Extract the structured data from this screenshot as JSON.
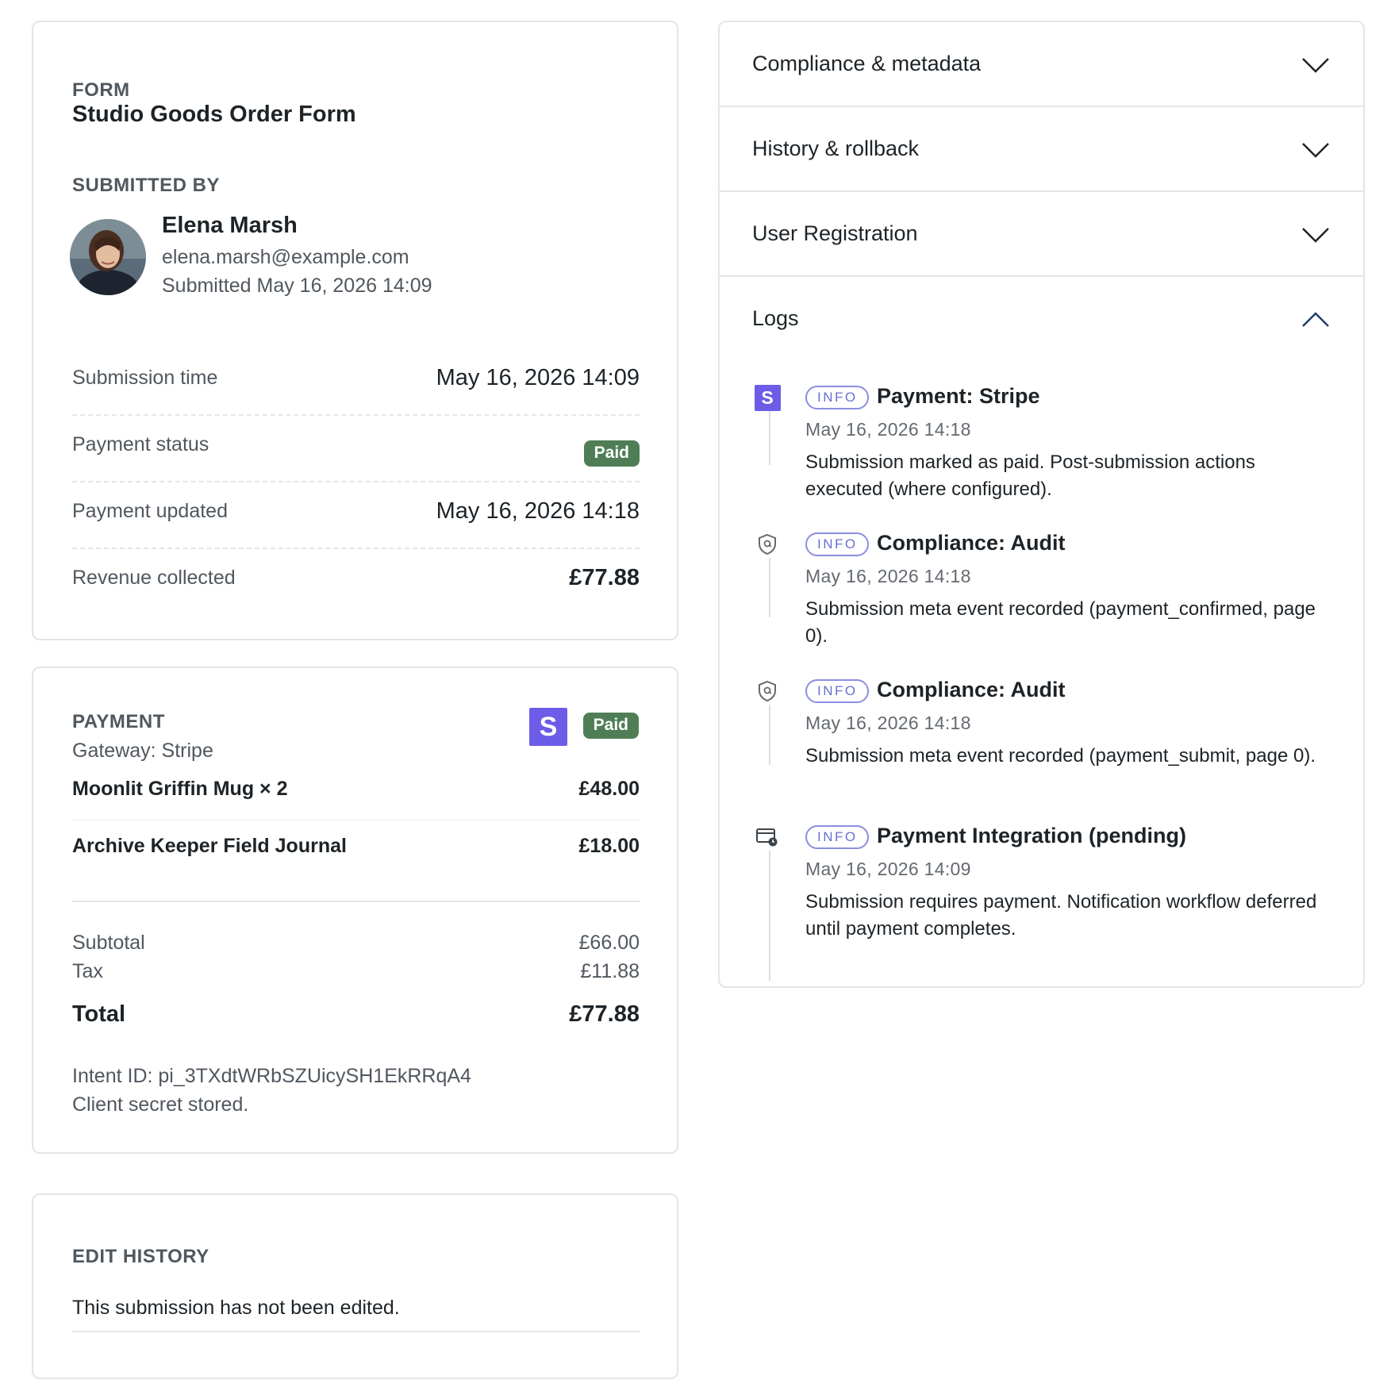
{
  "form_section": {
    "form_label": "FORM",
    "form_title": "Studio Goods Order Form",
    "submitted_by_label": "SUBMITTED BY",
    "user": {
      "name": "Elena Marsh",
      "email": "elena.marsh@example.com",
      "submitted": "Submitted May 16, 2026 14:09"
    },
    "rows": [
      {
        "label": "Submission time",
        "value": "May 16, 2026 14:09"
      },
      {
        "label": "Payment status",
        "value": "Paid"
      },
      {
        "label": "Payment updated",
        "value": "May 16, 2026 14:18"
      },
      {
        "label": "Revenue collected",
        "value": "£77.88"
      }
    ]
  },
  "payment_section": {
    "label": "PAYMENT",
    "gateway": "Gateway: Stripe",
    "gateway_logo_letter": "S",
    "status_badge": "Paid",
    "items": [
      {
        "name": "Moonlit Griffin Mug × 2",
        "price": "£48.00"
      },
      {
        "name": "Archive Keeper Field Journal",
        "price": "£18.00"
      }
    ],
    "subtotal_label": "Subtotal",
    "subtotal": "£66.00",
    "tax_label": "Tax",
    "tax": "£11.88",
    "total_label": "Total",
    "total": "£77.88",
    "intent_id": "Intent ID: pi_3TXdtWRbSZUicySH1EkRRqA4",
    "secret_note": "Client secret stored."
  },
  "edit_history": {
    "label": "EDIT HISTORY",
    "text": "This submission has not been edited."
  },
  "accordion": {
    "sections": [
      {
        "title": "Compliance & metadata",
        "state": "collapsed",
        "icon": "chevron-down-icon"
      },
      {
        "title": "History & rollback",
        "state": "collapsed",
        "icon": "chevron-down-icon"
      },
      {
        "title": "User Registration",
        "state": "collapsed",
        "icon": "chevron-down-icon"
      },
      {
        "title": "Logs",
        "state": "expanded",
        "icon": "chevron-up-icon"
      }
    ],
    "logs": [
      {
        "icon": "stripe-logo-icon",
        "icon_letter": "S",
        "level": "INFO",
        "title": "Payment: Stripe",
        "time": "May 16, 2026 14:18",
        "desc": "Submission marked as paid. Post-submission actions executed (where configured)."
      },
      {
        "icon": "shield-icon",
        "level": "INFO",
        "title": "Compliance: Audit",
        "time": "May 16, 2026 14:18",
        "desc": "Submission meta event recorded (payment_confirmed, page 0)."
      },
      {
        "icon": "shield-icon",
        "level": "INFO",
        "title": "Compliance: Audit",
        "time": "May 16, 2026 14:18",
        "desc": "Submission meta event recorded (payment_submit, page 0)."
      },
      {
        "icon": "card-clock-icon",
        "level": "INFO",
        "title": "Payment Integration (pending)",
        "time": "May 16, 2026 14:09",
        "desc": "Submission requires payment. Notification workflow deferred until payment completes."
      }
    ]
  },
  "colors": {
    "paid_badge": "#4f7e56",
    "stripe_brand": "#6c5ce7",
    "info_pill": "#6a6fd3",
    "border": "#e3e5e8"
  }
}
